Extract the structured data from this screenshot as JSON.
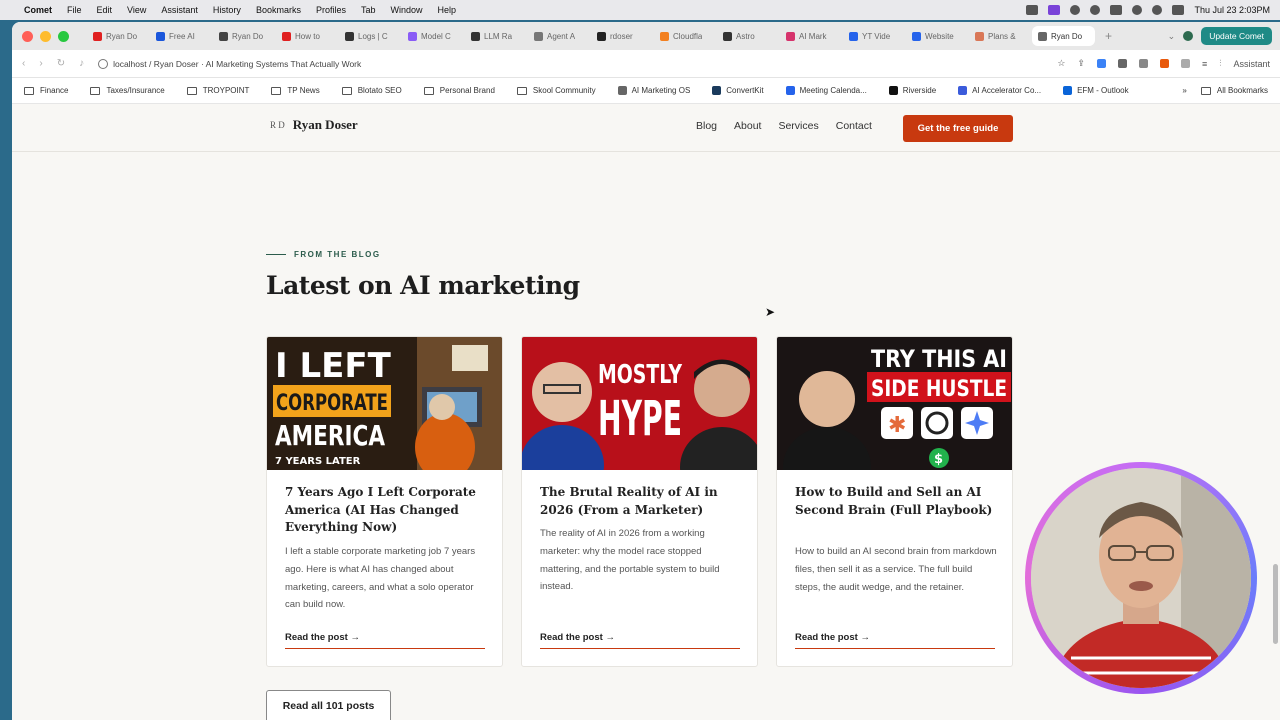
{
  "menubar": {
    "app": "Comet",
    "items": [
      "File",
      "Edit",
      "View",
      "Assistant",
      "History",
      "Bookmarks",
      "Profiles",
      "Tab",
      "Window",
      "Help"
    ],
    "clock": "Thu Jul 23  2:03PM"
  },
  "tabs": [
    {
      "label": "Ryan Do",
      "color": "#e02020"
    },
    {
      "label": "Free AI",
      "color": "#1a56db"
    },
    {
      "label": "Ryan Do",
      "color": "#444444"
    },
    {
      "label": "How to",
      "color": "#e02020"
    },
    {
      "label": "Logs | C",
      "color": "#333333"
    },
    {
      "label": "Model C",
      "color": "#8a5cf6"
    },
    {
      "label": "LLM Ra",
      "color": "#333333"
    },
    {
      "label": "Agent A",
      "color": "#777777"
    },
    {
      "label": "rdoser",
      "color": "#222222"
    },
    {
      "label": "Cloudfla",
      "color": "#f38020"
    },
    {
      "label": "Astro",
      "color": "#333333"
    },
    {
      "label": "AI Mark",
      "color": "#d6336c"
    },
    {
      "label": "YT Vide",
      "color": "#2563eb"
    },
    {
      "label": "Website",
      "color": "#2563eb"
    },
    {
      "label": "Plans &",
      "color": "#d97757"
    },
    {
      "label": "Ryan Do",
      "color": "#666666",
      "active": true
    }
  ],
  "update_button": "Update Comet",
  "address": {
    "url": "localhost / Ryan Doser · AI Marketing Systems That Actually Work",
    "assistant": "Assistant"
  },
  "bookmarks": [
    {
      "label": "Finance",
      "type": "folder"
    },
    {
      "label": "Taxes/Insurance",
      "type": "folder"
    },
    {
      "label": "TROYPOINT",
      "type": "folder"
    },
    {
      "label": "TP News",
      "type": "folder"
    },
    {
      "label": "Blotato SEO",
      "type": "folder"
    },
    {
      "label": "Personal Brand",
      "type": "folder"
    },
    {
      "label": "Skool Community",
      "type": "folder"
    },
    {
      "label": "AI Marketing OS",
      "type": "site",
      "color": "#666666"
    },
    {
      "label": "ConvertKit",
      "type": "site",
      "color": "#1a3a5c"
    },
    {
      "label": "Meeting Calenda...",
      "type": "site",
      "color": "#2563eb"
    },
    {
      "label": "Riverside",
      "type": "site",
      "color": "#111111"
    },
    {
      "label": "AI Accelerator Co...",
      "type": "site",
      "color": "#3b5bdb"
    },
    {
      "label": "EFM - Outlook",
      "type": "site",
      "color": "#0a64d8"
    }
  ],
  "all_bookmarks": "All Bookmarks",
  "site": {
    "logo": "Ryan Doser",
    "logo_mark": "R D",
    "nav": [
      "Blog",
      "About",
      "Services",
      "Contact"
    ],
    "cta": "Get the free guide",
    "eyebrow": "FROM THE BLOG",
    "title": "Latest on AI marketing",
    "read_all": "Read all 101 posts",
    "accent": "#c8390f"
  },
  "posts": [
    {
      "thumb_lines": [
        "I LEFT",
        "CORPORATE",
        "AMERICA"
      ],
      "thumb_caption": "7 YEARS LATER",
      "title": "7 Years Ago I Left Corporate America (AI Has Changed Everything Now)",
      "desc": "I left a stable corporate marketing job 7 years ago. Here is what AI has changed about marketing, careers, and what a solo operator can build now.",
      "cta": "Read the post →"
    },
    {
      "thumb_lines": [
        "MOSTLY",
        "HYPE"
      ],
      "title": "The Brutal Reality of AI in 2026 (From a Marketer)",
      "desc": "The reality of AI in 2026 from a working marketer: why the model race stopped mattering, and the portable system to build instead.",
      "cta": "Read the post →"
    },
    {
      "thumb_lines": [
        "TRY THIS AI",
        "SIDE HUSTLE"
      ],
      "title": "How to Build and Sell an AI Second Brain (Full Playbook)",
      "desc": "How to build an AI second brain from markdown files, then sell it as a service. The full build steps, the audit wedge, and the retainer.",
      "cta": "Read the post →"
    }
  ]
}
